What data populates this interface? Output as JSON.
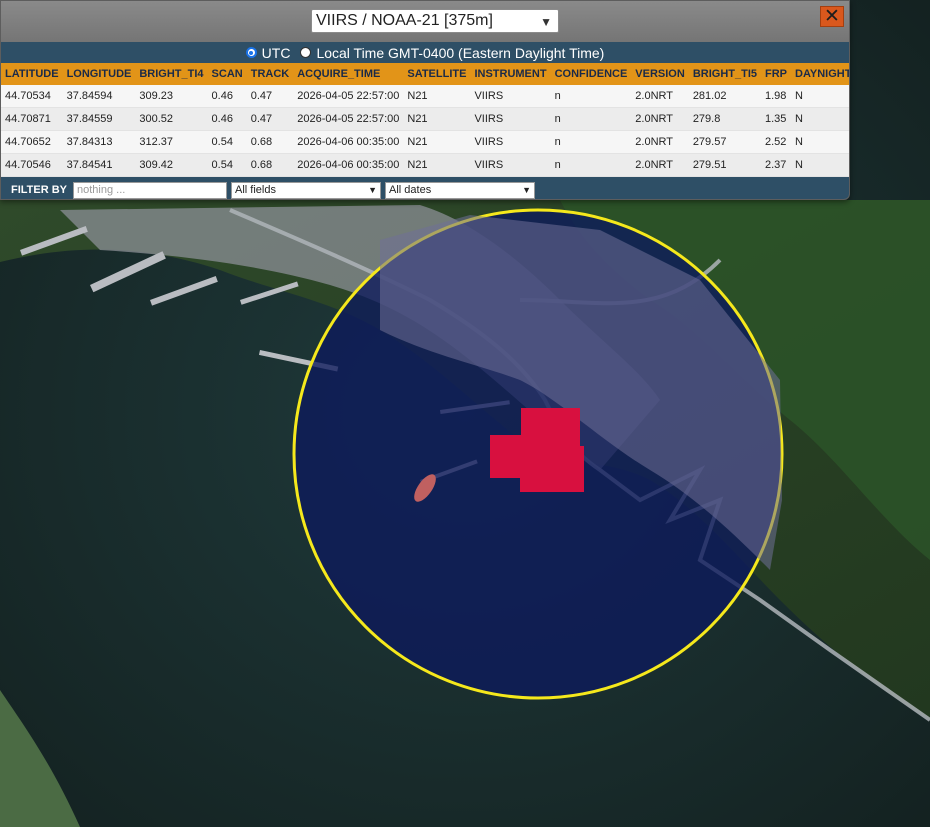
{
  "layer_selector": {
    "value": "VIIRS / NOAA-21 [375m]",
    "chevron_icon": "chevron-down-icon"
  },
  "close_button": {
    "label": "✕",
    "icon": "close-icon",
    "color": "#d9581d"
  },
  "time_options": [
    {
      "label": "UTC",
      "selected": true
    },
    {
      "label": "Local Time GMT-0400 (Eastern Daylight Time)",
      "selected": false
    }
  ],
  "table": {
    "columns": [
      "LATITUDE",
      "LONGITUDE",
      "BRIGHT_TI4",
      "SCAN",
      "TRACK",
      "ACQUIRE_TIME",
      "SATELLITE",
      "INSTRUMENT",
      "CONFIDENCE",
      "VERSION",
      "BRIGHT_TI5",
      "FRP",
      "DAYNIGHT"
    ],
    "rows": [
      [
        "44.70534",
        "37.84594",
        "309.23",
        "0.46",
        "0.47",
        "2026-04-05 22:57:00",
        "N21",
        "VIIRS",
        "n",
        "2.0NRT",
        "281.02",
        "1.98",
        "N"
      ],
      [
        "44.70871",
        "37.84559",
        "300.52",
        "0.46",
        "0.47",
        "2026-04-05 22:57:00",
        "N21",
        "VIIRS",
        "n",
        "2.0NRT",
        "279.8",
        "1.35",
        "N"
      ],
      [
        "44.70652",
        "37.84313",
        "312.37",
        "0.54",
        "0.68",
        "2026-04-06 00:35:00",
        "N21",
        "VIIRS",
        "n",
        "2.0NRT",
        "279.57",
        "2.52",
        "N"
      ],
      [
        "44.70546",
        "37.84541",
        "309.42",
        "0.54",
        "0.68",
        "2026-04-06 00:35:00",
        "N21",
        "VIIRS",
        "n",
        "2.0NRT",
        "279.51",
        "2.37",
        "N"
      ]
    ]
  },
  "filter": {
    "label": "FILTER BY",
    "placeholder": "nothing ...",
    "field_select": "All fields",
    "date_select": "All dates"
  },
  "map": {
    "selection_circle_color": "#f5e81c",
    "hotspot_color": "#d8103f",
    "sea_color": "#0e1a44"
  }
}
